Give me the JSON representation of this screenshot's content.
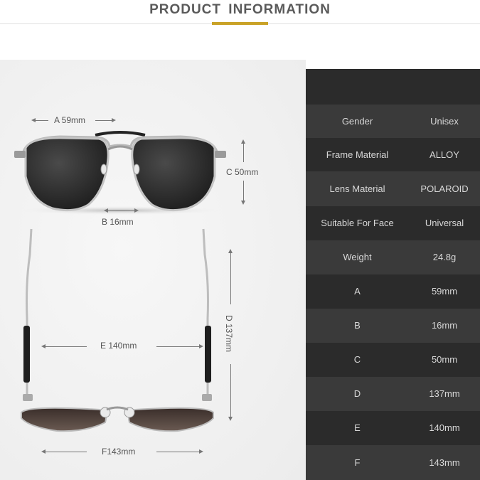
{
  "header": {
    "title": "PRODUCT  INFORMATION"
  },
  "dimensions": {
    "a": "A 59mm",
    "b": "B 16mm",
    "c": "C 50mm",
    "d": "D 137mm",
    "e": "E 140mm",
    "f": "F143mm"
  },
  "specs": [
    {
      "label": "Gender",
      "value": "Unisex"
    },
    {
      "label": "Frame Material",
      "value": "ALLOY"
    },
    {
      "label": "Lens Material",
      "value": "POLAROID"
    },
    {
      "label": "Suitable For Face",
      "value": "Universal"
    },
    {
      "label": "Weight",
      "value": "24.8g"
    },
    {
      "label": "A",
      "value": "59mm"
    },
    {
      "label": "B",
      "value": "16mm"
    },
    {
      "label": "C",
      "value": "50mm"
    },
    {
      "label": "D",
      "value": "137mm"
    },
    {
      "label": "E",
      "value": "140mm"
    },
    {
      "label": "F",
      "value": "143mm"
    }
  ],
  "colors": {
    "accent": "#c9a227",
    "table_dark": "#2b2b2b",
    "table_light": "#3a3a3a"
  }
}
